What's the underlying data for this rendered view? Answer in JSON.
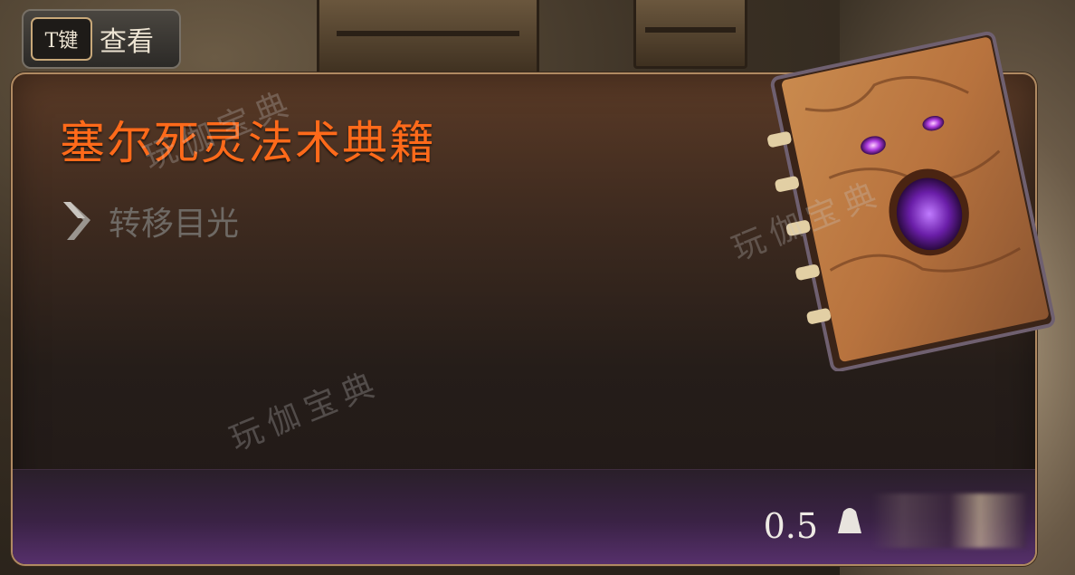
{
  "hint": {
    "key_label": "T键",
    "action_label": "查看"
  },
  "item": {
    "name": "塞尔死灵法术典籍",
    "action": "转移目光",
    "weight": "0.5"
  },
  "watermark": {
    "text": "玩伽宝典"
  },
  "colors": {
    "title": "#ff6a1a",
    "panel_border": "#b08a62",
    "footer_purple": "#56306b",
    "action_text": "#6e6964"
  },
  "icons": {
    "action": "chevron-right-icon",
    "weight": "weight-icon",
    "item": "necronomicon-book-icon"
  }
}
